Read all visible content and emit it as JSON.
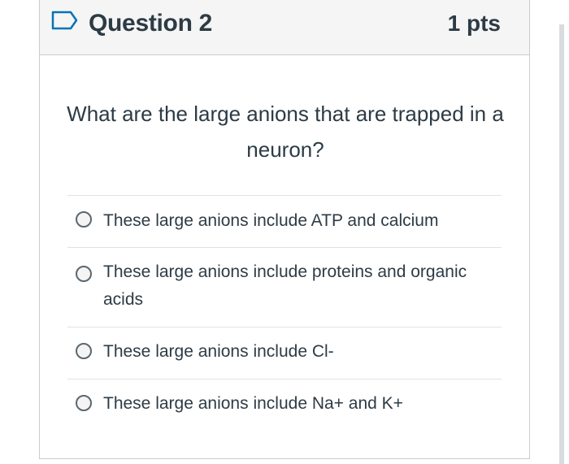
{
  "question": {
    "title": "Question 2",
    "points": "1 pts",
    "flag_icon": "flag-outline-icon",
    "text": "What are the large anions that are trapped in a neuron?"
  },
  "answers": [
    {
      "label": "These large anions include ATP and calcium"
    },
    {
      "label": "These large anions include proteins and organic acids"
    },
    {
      "label": "These large anions include Cl-"
    },
    {
      "label": "These large anions include Na+ and K+"
    }
  ],
  "colors": {
    "text": "#2d3b45",
    "header_bg": "#f5f5f5",
    "border": "#c7cdd1",
    "flag": "#0374b5"
  }
}
